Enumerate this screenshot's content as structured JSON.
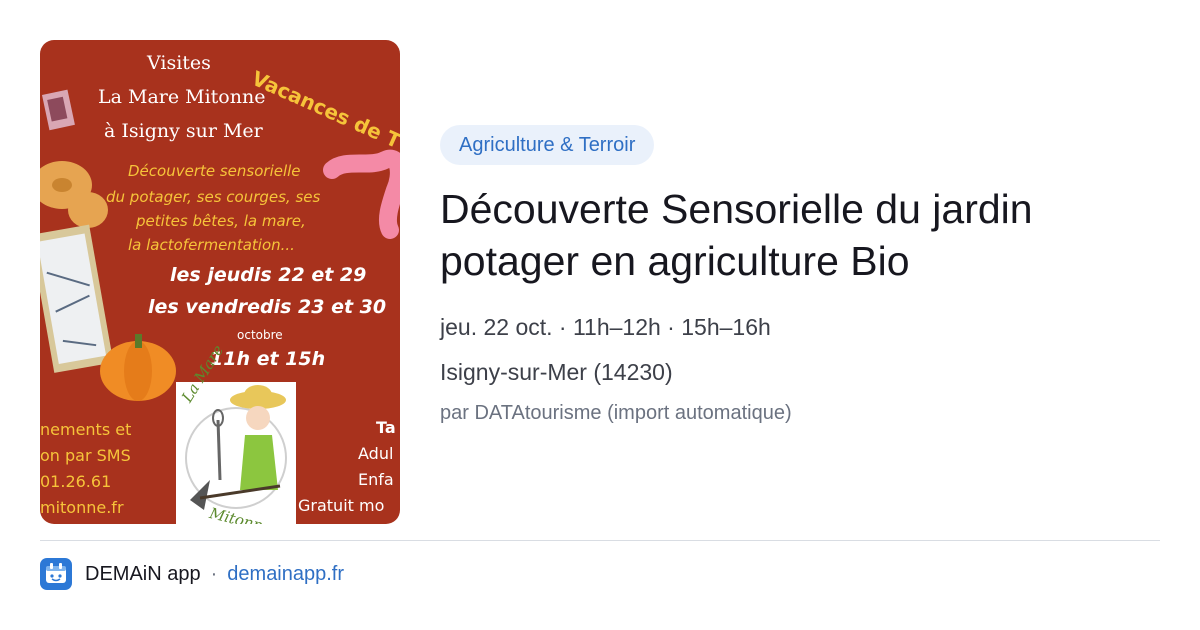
{
  "poster": {
    "title_lines": [
      "Visites",
      "La Mare Mitonne",
      "à Isigny sur Mer"
    ],
    "banner": "Vacances de T",
    "desc_lines": [
      "Découverte sensorielle",
      "du potager, ses courges, ses",
      "petites bêtes, la mare,",
      "la lactofermentation..."
    ],
    "dates": [
      "les jeudis 22 et 29",
      "les vendredis 23 et 30"
    ],
    "month": "octobre",
    "hours": "11h et 15h",
    "left_lines": [
      "nements et",
      "on par SMS",
      "01.26.61",
      "mitonne.fr"
    ],
    "right_lines": [
      "Ta",
      "Adul",
      "Enfa",
      "Gratuit mo"
    ],
    "logo_top": "La Mare",
    "logo_bottom": "Mitonne"
  },
  "category": "Agriculture & Terroir",
  "event": {
    "title": "Découverte Sensorielle du jardin potager en agriculture Bio",
    "schedule": "jeu. 22 oct. · 11h–12h · 15h–16h",
    "location": "Isigny-sur-Mer (14230)",
    "source": "par DATAtourisme (import automatique)"
  },
  "footer": {
    "app_name": "DEMAiN app",
    "separator": "·",
    "domain": "demainapp.fr",
    "icon": "demain-app-icon"
  },
  "colors": {
    "poster_bg": "#a8321d",
    "poster_yellow": "#f6c43a",
    "accent": "#2f6fc4",
    "badge_bg": "#eaf1fb"
  }
}
